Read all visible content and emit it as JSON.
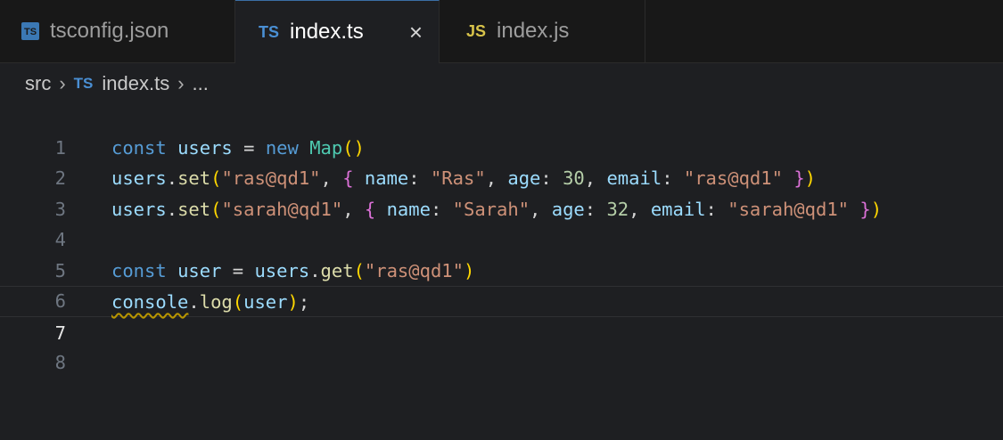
{
  "tabs": [
    {
      "icon": "TS",
      "label": "tsconfig.json",
      "active": false
    },
    {
      "icon": "TS",
      "label": "index.ts",
      "active": true,
      "close": "×"
    },
    {
      "icon": "JS",
      "label": "index.js",
      "active": false
    }
  ],
  "breadcrumb": {
    "folder": "src",
    "file_icon": "TS",
    "file": "index.ts",
    "more": "..."
  },
  "editor": {
    "active_line": 7,
    "lines": [
      {
        "n": "1",
        "code": ""
      },
      {
        "n": "2",
        "code": "const users = new Map()"
      },
      {
        "n": "3",
        "code": "users.set(\"ras@qd1\", { name: \"Ras\", age: 30, email: \"ras@qd1\" })"
      },
      {
        "n": "4",
        "code": "users.set(\"sarah@qd1\", { name: \"Sarah\", age: 32, email: \"sarah@qd1\" })"
      },
      {
        "n": "5",
        "code": ""
      },
      {
        "n": "6",
        "code": "const user = users.get(\"ras@qd1\")"
      },
      {
        "n": "7",
        "code": "console.log(user);"
      },
      {
        "n": "8",
        "code": ""
      }
    ]
  },
  "colors": {
    "keyword": "#569cd6",
    "variable": "#9cdcfe",
    "function": "#dcdcaa",
    "class": "#4ec9b0",
    "string": "#ce9178",
    "number": "#b5cea8"
  }
}
